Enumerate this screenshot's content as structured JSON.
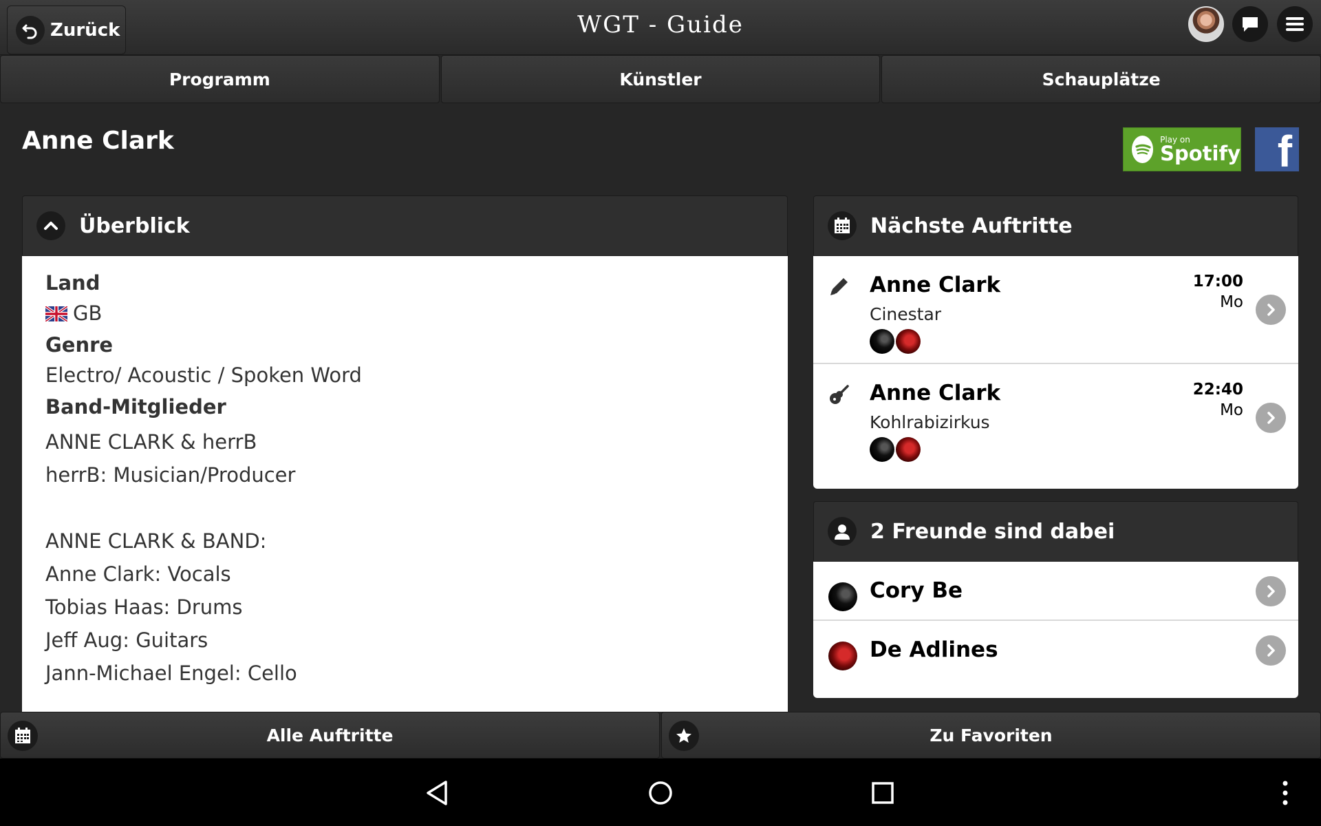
{
  "header": {
    "back_label": "Zurück",
    "title": "WGT - Guide"
  },
  "tabs": [
    {
      "label": "Programm"
    },
    {
      "label": "Künstler"
    },
    {
      "label": "Schauplätze"
    }
  ],
  "artist": {
    "name": "Anne Clark",
    "spotify_small": "Play on",
    "spotify_big": "Spotify",
    "facebook_glyph": "f"
  },
  "overview": {
    "title": "Überblick",
    "country_label": "Land",
    "country_value": "GB",
    "genre_label": "Genre",
    "genre_value": "Electro/ Acoustic / Spoken Word",
    "members_label": "Band-Mitglieder",
    "members_text": "ANNE CLARK & herrB\nherrB: Musician/Producer\n\nANNE CLARK & BAND:\nAnne Clark: Vocals\nTobias Haas: Drums\nJeff Aug: Guitars\nJann-Michael Engel: Cello"
  },
  "next_shows": {
    "title": "Nächste Auftritte",
    "items": [
      {
        "name": "Anne Clark",
        "venue": "Cinestar",
        "time": "17:00",
        "day": "Mo",
        "icon": "pencil-icon"
      },
      {
        "name": "Anne Clark",
        "venue": "Kohlrabizirkus",
        "time": "22:40",
        "day": "Mo",
        "icon": "guitar-icon"
      }
    ]
  },
  "friends": {
    "title": "2 Freunde sind dabei",
    "items": [
      {
        "name": "Cory Be"
      },
      {
        "name": "De Adlines"
      }
    ]
  },
  "bottom": {
    "all_shows": "Alle Auftritte",
    "favorite": "Zu Favoriten"
  },
  "colors": {
    "spotify": "#5da22a",
    "facebook": "#3b5998",
    "background": "#262626"
  }
}
